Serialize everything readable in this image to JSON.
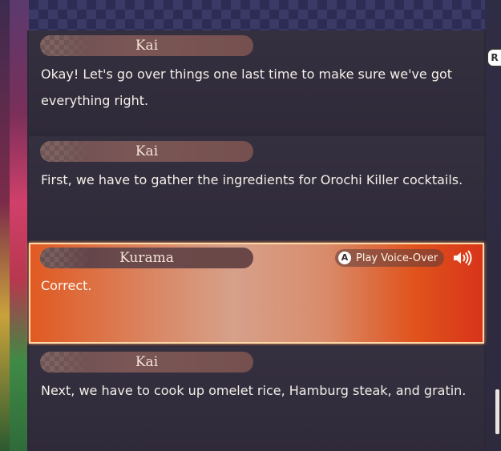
{
  "log": {
    "entries": [
      {
        "speaker": "Kai",
        "text": "Okay! Let's go over things one last time to make sure we've got everything right."
      },
      {
        "speaker": "Kai",
        "text": "First, we have to gather the ingredients for Orochi Killer cocktails."
      },
      {
        "speaker": "Kurama",
        "text": "Correct."
      },
      {
        "speaker": "Kai",
        "text": "Next, we have to cook up omelet rice, Hamburg steak, and gratin."
      }
    ],
    "selected_index": 2,
    "voice_over": {
      "button_glyph": "A",
      "label": "Play Voice-Over",
      "icon": "speaker-icon"
    }
  },
  "controls": {
    "shoulder_button": "R"
  },
  "colors": {
    "highlight_border": "#ffd9a8",
    "highlight_orange": "#e05a22",
    "entry_bg": "#35303f"
  }
}
